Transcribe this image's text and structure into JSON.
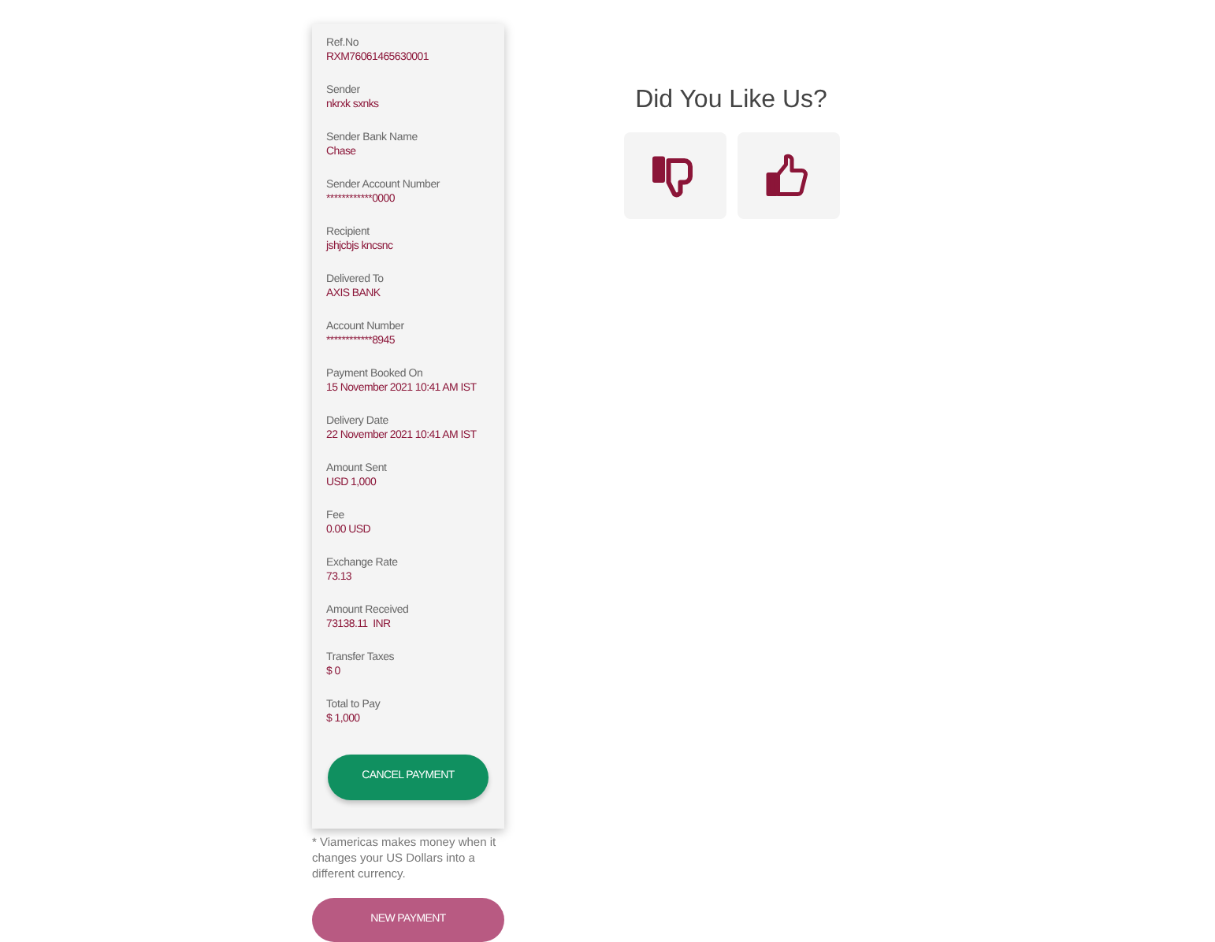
{
  "details": [
    {
      "label": "Ref.No",
      "value": "RXM76061465630001"
    },
    {
      "label": "Sender",
      "value": "nkrxk sxnks"
    },
    {
      "label": "Sender Bank Name",
      "value": "Chase"
    },
    {
      "label": "Sender Account Number",
      "value": "************0000"
    },
    {
      "label": "Recipient",
      "value": "jshjcbjs kncsnc"
    },
    {
      "label": "Delivered To",
      "value": "AXIS BANK"
    },
    {
      "label": "Account Number",
      "value": "************8945"
    },
    {
      "label": "Payment Booked On",
      "value": "15 November 2021 10:41 AM IST"
    },
    {
      "label": "Delivery Date",
      "value": "22 November 2021 10:41 AM IST"
    },
    {
      "label": "Amount Sent",
      "value": "USD 1,000"
    },
    {
      "label": "Fee",
      "value": "0.00 USD"
    },
    {
      "label": "Exchange Rate",
      "value": "73.13"
    },
    {
      "label": "Amount Received",
      "value": "73138.11  INR"
    },
    {
      "label": "Transfer Taxes",
      "value": "$ 0"
    },
    {
      "label": "Total to Pay",
      "value": "$ 1,000"
    }
  ],
  "cancel_button": "CANCEL PAYMENT",
  "note": "* Viamericas makes money when it changes your US Dollars into a different currency.",
  "new_payment_button": "NEW PAYMENT",
  "feedback": {
    "title": "Did You Like Us?"
  }
}
